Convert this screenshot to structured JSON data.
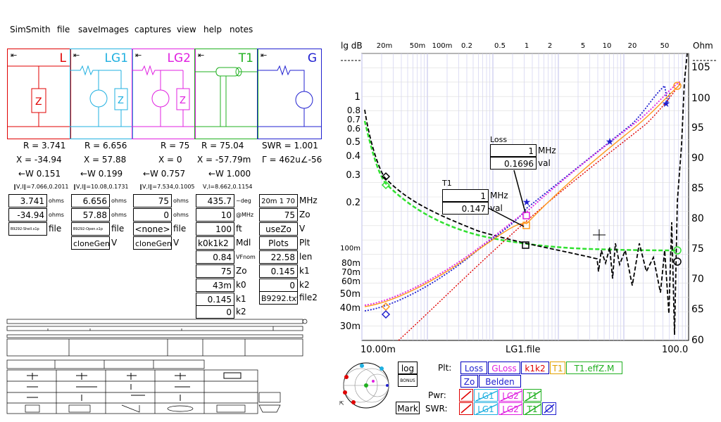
{
  "menu": [
    "SimSmith",
    "file",
    "saveImages",
    "captures",
    "view",
    "help",
    "notes"
  ],
  "blocks": [
    {
      "name": "L",
      "color": "#e00000"
    },
    {
      "name": "LG1",
      "color": "#20b0e0"
    },
    {
      "name": "LG2",
      "color": "#e020e0"
    },
    {
      "name": "T1",
      "color": "#20b020"
    },
    {
      "name": "G",
      "color": "#2020d0"
    }
  ],
  "readouts": {
    "L": {
      "r": "R = 3.741",
      "x": "X = -34.94",
      "w": "←W 0.151",
      "vi": "‖V,I‖=7.066,0.2011"
    },
    "LG1": {
      "r": "R = 6.656",
      "x": "X = 57.88",
      "w": "←W 0.199",
      "vi": "‖V,I‖=10.08,0.1731"
    },
    "LG2": {
      "r": "R = 75",
      "x": "X = 0",
      "w": "←W 0.757",
      "vi": "‖V,I‖=7.534,0.1005"
    },
    "T1": {
      "r": "R = 75.04",
      "x": "X = -57.79m",
      "w": "←W 1.000",
      "vi": "V,I=8.662,0.1154"
    },
    "G": {
      "r": "SWR = 1.001",
      "x": "Γ = 462u∠-56"
    }
  },
  "params": {
    "L": {
      "v1": "3.741",
      "u1": "ohms",
      "v2": "-34.94",
      "u2": "ohms",
      "file": "B9292-Shell.s1p",
      "fl": "file"
    },
    "LG1": {
      "v1": "6.656",
      "u1": "ohms",
      "v2": "57.88",
      "u2": "ohms",
      "file": "B9292-Open.s1p",
      "fl": "file",
      "clone": "cloneGen;",
      "cv": "V"
    },
    "LG2": {
      "v1": "75",
      "u1": "ohms",
      "v2": "0",
      "u2": "ohms",
      "file": "<none>",
      "fl": "file",
      "clone": "cloneGen;",
      "cv": "V"
    },
    "T1": {
      "v1": "435.7",
      "u1": "~deg",
      "v2": "10",
      "u2": "@MHz",
      "v3": "100",
      "u3": "ft",
      "v4": "k0k1k2",
      "u4": "Mdl",
      "v5": "0.84",
      "u5": "VFnom",
      "v6": "75",
      "u6": "Zo",
      "v7": "43m",
      "u7": "k0",
      "v8": "0.145",
      "u8": "k1",
      "v9": "0",
      "u9": "k2"
    },
    "G": {
      "v1": "20m 1 70",
      "u1": "MHz",
      "v2": "75",
      "u2": "Zo",
      "v3": "useZo",
      "u3": "V",
      "v4": "Plots",
      "u4": "Plt",
      "v5": "22.58",
      "u5": "len",
      "v6": "0.145",
      "u6": "k1",
      "v7": "0",
      "u7": "k2",
      "v8": "B9292.txt",
      "u8": "file2"
    }
  },
  "chart": {
    "left_axis_label": "lg dB",
    "right_axis_label": "Ohm",
    "top_ticks": [
      "20m",
      "50m",
      "100m",
      "0.2",
      "0.5",
      "1",
      "2",
      "5",
      "10",
      "20",
      "50"
    ],
    "left_ticks": [
      "1",
      "0.8",
      "0.7",
      "0.6",
      "0.5",
      "0.4",
      "0.3",
      "0.2",
      "100m",
      "80m",
      "70m",
      "60m",
      "50m",
      "40m",
      "30m"
    ],
    "right_ticks": [
      "105",
      "100",
      "95",
      "90",
      "85",
      "80",
      "75",
      "70",
      "65",
      "60"
    ],
    "bottom_left": "10.00m",
    "bottom_center": "LG1.file",
    "bottom_right": "100.0",
    "marker_loss": {
      "title": "Loss",
      "freq": "1",
      "unit": "MHz",
      "val": "0.1696",
      "vunit": "val"
    },
    "marker_t1": {
      "title": "T1",
      "freq": "1",
      "unit": "MHz",
      "val": "0.147",
      "vunit": "val"
    }
  },
  "bottom": {
    "log": "log",
    "bonus": "BONUS",
    "mark": "Mark",
    "plt_label": "Plt:",
    "plt_buttons": [
      {
        "label": "Loss",
        "color": "#2020d0"
      },
      {
        "label": "GLoss",
        "color": "#e020e0"
      },
      {
        "label": "k1k2",
        "color": "#e00000"
      },
      {
        "label": "T1",
        "color": "#e0a000"
      },
      {
        "label": "T1.effZ.M",
        "color": "#20b020"
      }
    ],
    "row2": [
      "Zo",
      "Belden"
    ],
    "pwr_label": "Pwr:",
    "swr_label": "SWR:",
    "pwr_items": [
      "LG1",
      "LG2",
      "T1"
    ],
    "swr_items": [
      "LG1",
      "LG2",
      "T1"
    ]
  },
  "colors": {
    "L": "#e00000",
    "LG1": "#20b0e0",
    "LG2": "#e020e0",
    "T1": "#20b020",
    "G": "#2020d0"
  }
}
